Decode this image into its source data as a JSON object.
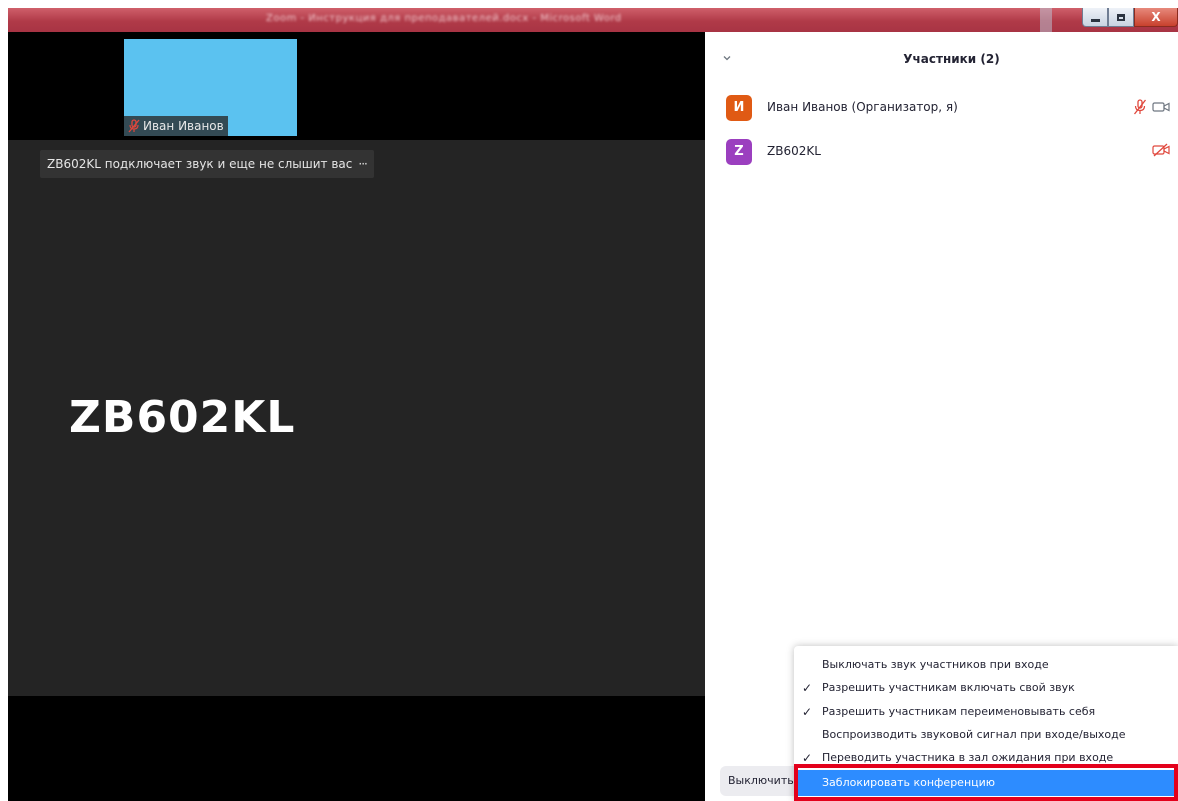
{
  "window": {
    "title": "Zoom - Инструкция для преподавателей.docx - Microsoft Word",
    "controls": {
      "minimize_icon": "minimize-icon",
      "maximize_icon": "maximize-icon",
      "close_label": "X"
    }
  },
  "video": {
    "thumbnail": {
      "name": "Иван Иванов",
      "muted": true,
      "bg_color": "#5bc2f0"
    },
    "notification": {
      "text": "ZB602KL подключает звук и еще не слышит вас",
      "more": "···"
    },
    "active_speaker": "ZB602KL"
  },
  "panel": {
    "title": "Участники (2)",
    "participants": [
      {
        "avatar_letter": "И",
        "avatar_color": "#e05a14",
        "name": "Иван Иванов (Организатор, я)",
        "mic_muted": true,
        "video_on": true
      },
      {
        "avatar_letter": "Z",
        "avatar_color": "#9b3fbf",
        "name": "ZB602KL",
        "mic_muted": false,
        "video_on": false
      }
    ],
    "mute_all_label": "Выключить звук для всех"
  },
  "menu": {
    "items": [
      {
        "label": "Выключать звук участников при входе",
        "checked": false
      },
      {
        "label": "Разрешить участникам включать свой звук",
        "checked": true
      },
      {
        "label": "Разрешить участникам переименовывать себя",
        "checked": true
      },
      {
        "label": "Воспроизводить звуковой сигнал при входе/выходе",
        "checked": false
      },
      {
        "label": "Переводить участника в зал ожидания при входе",
        "checked": true
      },
      {
        "label": "Заблокировать конференцию",
        "checked": false,
        "selected": true
      }
    ],
    "check_glyph": "✓",
    "highlight_color": "#e3001b"
  }
}
